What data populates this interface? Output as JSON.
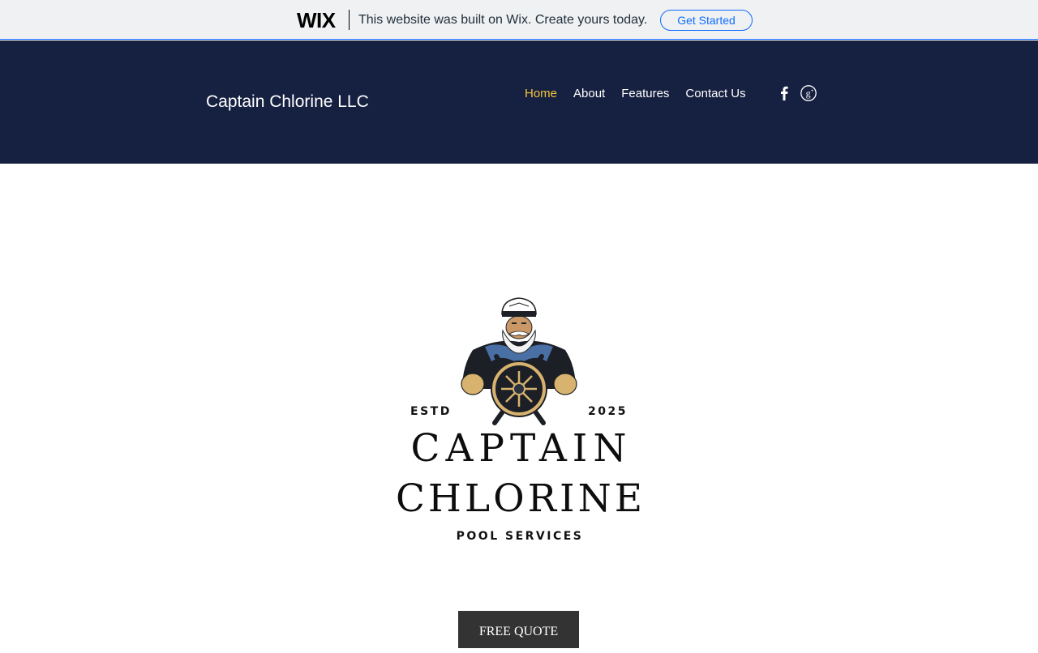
{
  "wix_banner": {
    "logo": "WIX",
    "message": "This website was built on Wix. Create yours today.",
    "cta_label": "Get Started"
  },
  "header": {
    "site_title": "Captain Chlorine LLC",
    "nav": [
      {
        "label": "Home",
        "active": true
      },
      {
        "label": "About",
        "active": false
      },
      {
        "label": "Features",
        "active": false
      },
      {
        "label": "Contact Us",
        "active": false
      }
    ],
    "social": [
      {
        "icon": "facebook-icon"
      },
      {
        "icon": "google-plus-icon"
      }
    ]
  },
  "logo": {
    "estd_label": "ESTD",
    "year": "2025",
    "line1": "CAPTAIN",
    "line2": "CHLORINE",
    "tagline": "POOL SERVICES"
  },
  "cta": {
    "label": "FREE QUOTE"
  },
  "colors": {
    "header_bg": "#162040",
    "nav_active": "#f5c63d",
    "banner_bg": "#eff1f2",
    "wix_blue": "#116dff",
    "button_bg": "#333333"
  }
}
